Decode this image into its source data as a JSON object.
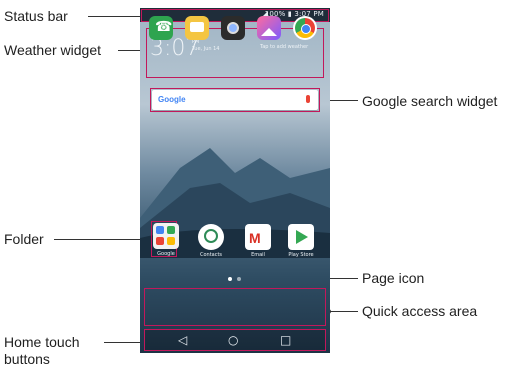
{
  "callouts": {
    "status_bar": "Status bar",
    "weather_widget": "Weather widget",
    "google_search_widget": "Google search widget",
    "folder": "Folder",
    "page_icon": "Page icon",
    "quick_access_area": "Quick access area",
    "home_touch_buttons_line1": "Home touch",
    "home_touch_buttons_line2": "buttons"
  },
  "phone": {
    "status_text": "100% ▮ 3:07 PM",
    "weather": {
      "time": "3:07",
      "period": "PM",
      "date": "Tue, Jun 14",
      "tap_text": "Tap to add weather"
    },
    "search": {
      "logo": "Google"
    },
    "apps": [
      {
        "label": "Google"
      },
      {
        "label": "Contacts"
      },
      {
        "label": "Email"
      },
      {
        "label": "Play Store"
      }
    ],
    "dock": [
      "phone",
      "messages",
      "camera",
      "gallery",
      "chrome"
    ],
    "nav": {
      "back": "◁",
      "home": "○",
      "recents": "□"
    }
  },
  "colors": {
    "accent": "#c2185b"
  }
}
